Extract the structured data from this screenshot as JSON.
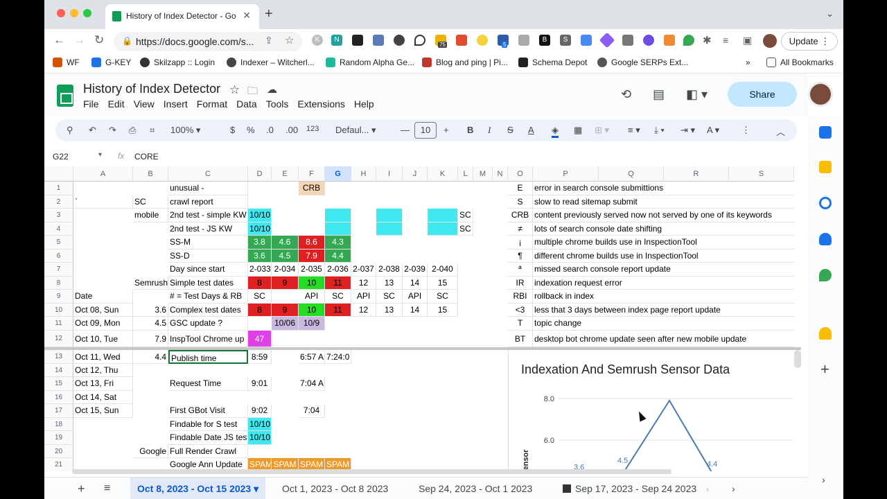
{
  "browser": {
    "tab_title": "History of Index Detector - Go",
    "url": "https://docs.google.com/s...",
    "update_label": "Update",
    "ext_badges": [
      "75",
      "5"
    ]
  },
  "bookmarks": [
    "WF",
    "G-KEY",
    "Skilzapp :: Login",
    "Indexer – Witcherl...",
    "Random Alpha Ge...",
    "Blog and ping | Pi...",
    "Schema Depot",
    "Google SERPs Ext...",
    "All Bookmarks"
  ],
  "sheets": {
    "title": "History of Index Detector",
    "menus": [
      "File",
      "Edit",
      "View",
      "Insert",
      "Format",
      "Data",
      "Tools",
      "Extensions",
      "Help"
    ],
    "share_label": "Share",
    "zoom": "100%",
    "font": "Defaul...",
    "font_size": "10",
    "num_format": "123",
    "cell_ref": "G22",
    "formula": "CORE",
    "format_glyphs": [
      "$",
      "%",
      ".0",
      ".00"
    ]
  },
  "columns": [
    "A",
    "B",
    "C",
    "D",
    "E",
    "F",
    "G",
    "H",
    "I",
    "J",
    "K",
    "L",
    "M",
    "N",
    "O",
    "P",
    "Q",
    "R",
    "S"
  ],
  "rows": [
    "1",
    "2",
    "3",
    "4",
    "5",
    "6",
    "7",
    "8",
    "9",
    "10",
    "11",
    "12",
    "13",
    "14",
    "15",
    "16",
    "17",
    "18",
    "19",
    "20",
    "21"
  ],
  "cells": {
    "r1": {
      "c": "unusual -",
      "f": "CRB",
      "o": "E",
      "p": "error in search console submittions"
    },
    "r2": {
      "a": "`",
      "b": "SC",
      "c": "crawl report",
      "o": "S",
      "p": "slow to read sitemap submit"
    },
    "r3": {
      "b": "mobile",
      "c": "2nd test - simple KW",
      "d": "10/10",
      "l": "SC",
      "o": "CRB",
      "p": "content previously served now not served by one of its keywords"
    },
    "r4": {
      "c": "2nd test - JS KW",
      "d": "10/10",
      "l": "SC",
      "o": "≠",
      "p": "lots of search console date shifting"
    },
    "r5": {
      "c": "SS-M",
      "d": "3.8",
      "e": "4.6",
      "f": "8.6",
      "g": "4.3",
      "o": "¡",
      "p": "multiple chrome builds use in InspectionTool"
    },
    "r6": {
      "c": "SS-D",
      "d": "3.6",
      "e": "4.5",
      "f": "7.9",
      "g": "4.4",
      "o": "¶",
      "p": "different chrome builds use in InspectionTool"
    },
    "r7": {
      "c": "Day since start",
      "d": "2-033",
      "e": "2-034",
      "f": "2-035",
      "g": "2-036",
      "h": "2-037",
      "i": "2-038",
      "j": "2-039",
      "k": "2-040",
      "o": "ª",
      "p": "missed search console report update"
    },
    "r8": {
      "b": "Semrush",
      "c": "Simple test dates",
      "d": "8",
      "e": "9",
      "f": "10",
      "g": "11",
      "h": "12",
      "i": "13",
      "j": "14",
      "k": "15",
      "o": "IR",
      "p": "indexation request error"
    },
    "r9": {
      "a": "Date",
      "c": "# = Test Days & RB",
      "d": "SC",
      "f": "API",
      "g": "SC",
      "h": "API",
      "i": "SC",
      "j": "API",
      "k": "SC",
      "o": "RBI",
      "p": "rollback in index"
    },
    "r10": {
      "a": "Oct 08, Sun",
      "b": "3.6",
      "c": "Complex  test dates",
      "d": "8",
      "e": "9",
      "f": "10",
      "g": "11",
      "h": "12",
      "i": "13",
      "j": "14",
      "k": "15",
      "o": "<3",
      "p": "less that 3 days between index page report update"
    },
    "r11": {
      "a": "Oct 09, Mon",
      "b": "4.5",
      "c": "GSC update ?",
      "e": "10/06",
      "f": "10/9",
      "o": "T",
      "p": "topic change"
    },
    "r12": {
      "a": "Oct 10, Tue",
      "b": "7.9",
      "c": "InspTool Chrome up",
      "d": "47",
      "o": "BT",
      "p": "desktop bot chrome update seen after new mobile update"
    },
    "r13": {
      "a": "Oct 11, Wed",
      "b": "4.4",
      "c": "Publish time",
      "d": "8:59",
      "f": "6:57 A",
      "g": "7:24:0"
    },
    "r14": {
      "a": "Oct 12, Thu"
    },
    "r15": {
      "a": "Oct 13, Fri",
      "c": "Request Time",
      "d": "9:01",
      "f": "7:04 AM"
    },
    "r16": {
      "a": "Oct 14, Sat"
    },
    "r17": {
      "a": "Oct 15, Sun",
      "c": "First GBot Visit",
      "d": "9:02",
      "f": "7:04"
    },
    "r18": {
      "c": "Findable for S test",
      "d": "10/10"
    },
    "r19": {
      "c": "Findable Date JS test",
      "d": "10/10"
    },
    "r20": {
      "b": "Google",
      "c": "Full Render Crawl"
    },
    "r21": {
      "c": "Google Ann Update",
      "d": "SPAM",
      "e": "SPAM",
      "f": "SPAM",
      "g": "SPAM"
    }
  },
  "chart_data": {
    "type": "line",
    "title": "Indexation And Semrush Sensor Data",
    "ylabel": "ensor",
    "yticks": [
      "8.0",
      "6.0"
    ],
    "ylim": [
      4.0,
      8.5
    ],
    "series": [
      {
        "values": [
          3.6,
          4.5,
          7.9,
          4.4
        ]
      }
    ],
    "data_labels": [
      "3.6",
      "4.5",
      "4.4"
    ]
  },
  "sheet_tabs": [
    "Oct 8, 2023 - Oct 15 2023",
    "Oct 1, 2023 - Oct 8 2023",
    "Sep 24, 2023 - Oct 1 2023",
    "Sep 17, 2023 - Sep 24 2023"
  ],
  "colors": {
    "red": "#e02020",
    "green": "#34a853",
    "bright_green": "#22dd22",
    "cyan": "#40e8ef",
    "magenta": "#e040e8",
    "lavender": "#c9b8e0",
    "peach": "#f6d5b2",
    "orange": "#ee9a2b",
    "accent": "#0b57d0"
  }
}
